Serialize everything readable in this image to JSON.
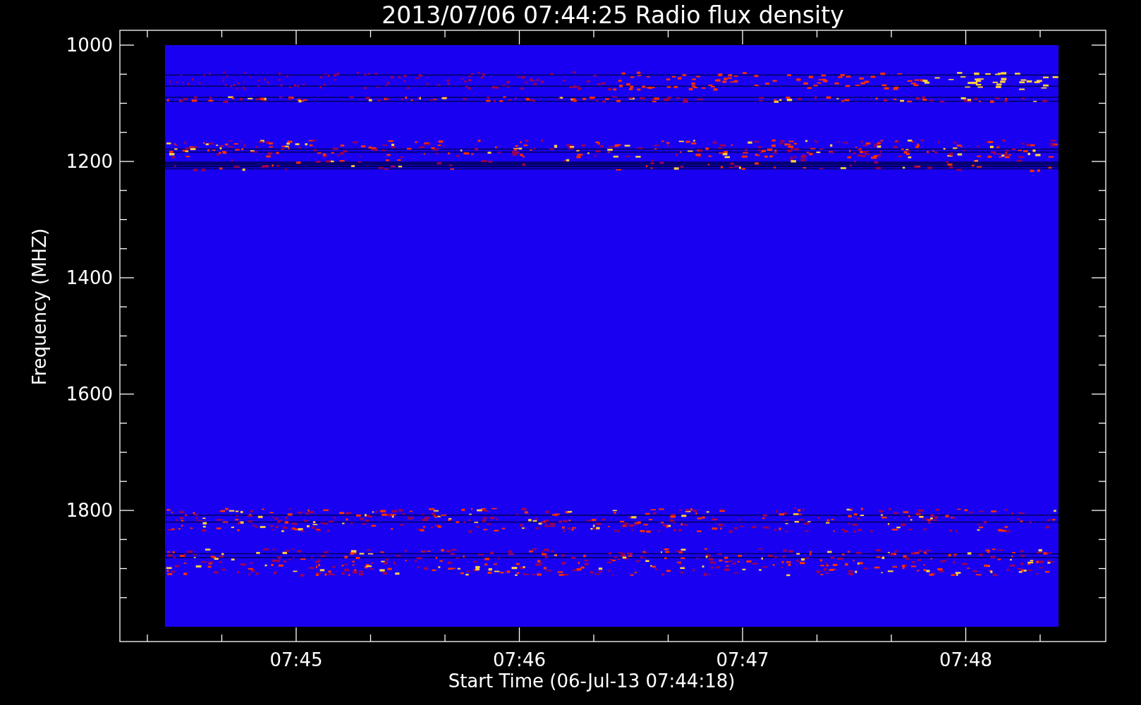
{
  "title": "2013/07/06 07:44:25 Radio flux density",
  "y_axis": {
    "label": "Frequency (MHZ)",
    "ticks": [
      "1000",
      "1200",
      "1400",
      "1600",
      "1800"
    ]
  },
  "x_axis": {
    "label": "Start Time (06-Jul-13 07:44:18)",
    "ticks": [
      "07:45",
      "07:46",
      "07:47",
      "07:48"
    ]
  }
}
